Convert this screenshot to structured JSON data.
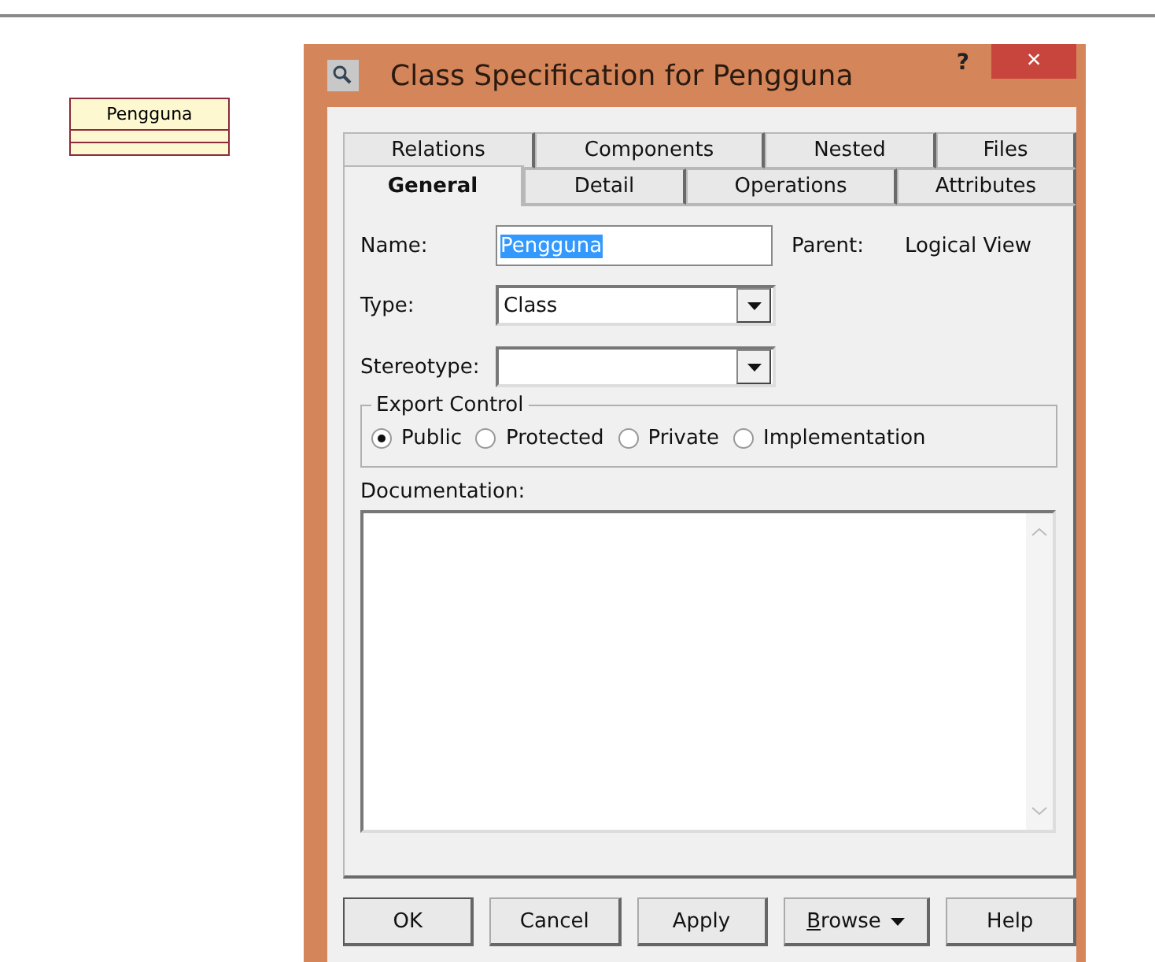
{
  "diagram": {
    "class_name": "Pengguna"
  },
  "dialog": {
    "title": "Class Specification for Pengguna",
    "help": "?",
    "close": "×"
  },
  "tab_rows": [
    [
      {
        "label": "Relations",
        "selected": false
      },
      {
        "label": "Components",
        "selected": false
      },
      {
        "label": "Nested",
        "selected": false
      },
      {
        "label": "Files",
        "selected": false
      }
    ],
    [
      {
        "label": "General",
        "selected": true
      },
      {
        "label": "Detail",
        "selected": false
      },
      {
        "label": "Operations",
        "selected": false
      },
      {
        "label": "Attributes",
        "selected": false
      }
    ]
  ],
  "name": {
    "label": "Name:",
    "value": "Pengguna",
    "value_selected": true
  },
  "parent": {
    "label": "Parent:",
    "value": "Logical View"
  },
  "type": {
    "label": "Type:",
    "value": "Class"
  },
  "stereotype": {
    "label": "Stereotype:"
  },
  "export_control": {
    "title": "Export Control",
    "options": [
      {
        "label": "Public",
        "selected": true
      },
      {
        "label": "Protected",
        "selected": false
      },
      {
        "label": "Private",
        "selected": false
      },
      {
        "label": "Implementation",
        "selected": false
      }
    ]
  },
  "documentation": {
    "label": "Documentation:"
  },
  "buttons": [
    {
      "label": "OK",
      "default": true,
      "dropdown": false,
      "underline_first": false
    },
    {
      "label": "Cancel",
      "default": false,
      "dropdown": false,
      "underline_first": false
    },
    {
      "label": "Apply",
      "default": false,
      "dropdown": false,
      "underline_first": false
    },
    {
      "label": "Browse",
      "default": false,
      "dropdown": true,
      "underline_first": true
    },
    {
      "label": "Help",
      "default": false,
      "dropdown": false,
      "underline_first": false
    }
  ]
}
